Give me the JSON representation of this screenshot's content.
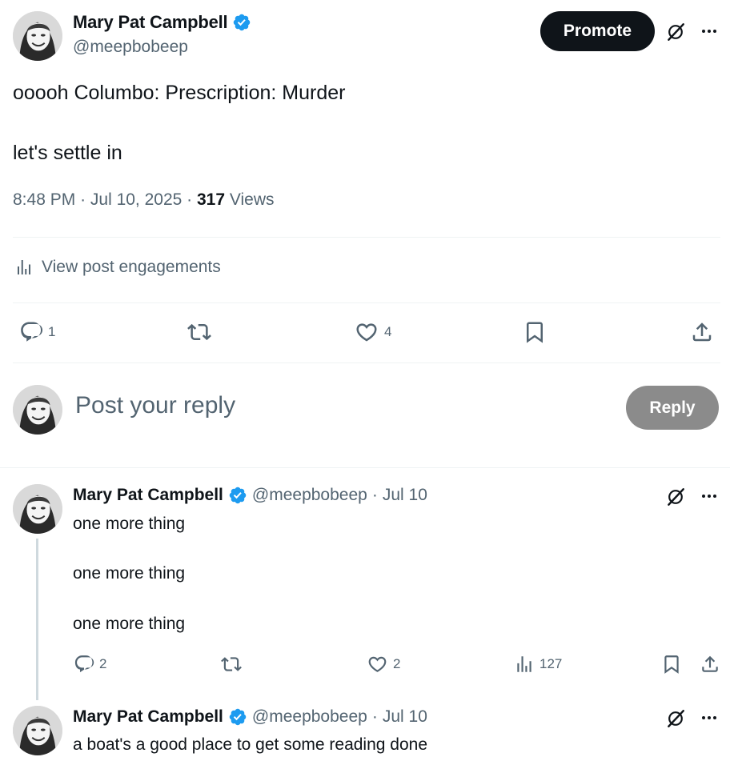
{
  "main_post": {
    "author": {
      "name": "Mary Pat Campbell",
      "handle": "@meepbobeep",
      "verified": true
    },
    "promote_label": "Promote",
    "text_line_1": "ooooh Columbo: Prescription: Murder",
    "text_line_2": "let's settle in",
    "time": "8:48 PM",
    "date": "Jul 10, 2025",
    "views_count": "317",
    "views_label": "Views",
    "engagements_label": "View post engagements",
    "actions": {
      "replies": "1",
      "reposts": "",
      "likes": "4"
    }
  },
  "composer": {
    "placeholder": "Post your reply",
    "reply_label": "Reply"
  },
  "replies": [
    {
      "name": "Mary Pat Campbell",
      "handle": "@meepbobeep",
      "sep": "·",
      "date": "Jul 10",
      "lines": [
        "one more thing",
        "one more thing",
        "one more thing"
      ],
      "stats": {
        "replies": "2",
        "reposts": "",
        "likes": "2",
        "views": "127"
      }
    },
    {
      "name": "Mary Pat Campbell",
      "handle": "@meepbobeep",
      "sep": "·",
      "date": "Jul 10",
      "lines": [
        "a boat's a good place to get some reading done"
      ]
    }
  ],
  "colors": {
    "text_primary": "#0f1419",
    "text_secondary": "#536471",
    "verified_blue": "#1d9bf0",
    "promote_bg": "#0f1419",
    "reply_button_bg": "#8b8b8b",
    "divider": "#eff3f4"
  },
  "icons": [
    "verified-badge-icon",
    "grok-icon",
    "more-icon",
    "analytics-icon",
    "reply-icon",
    "repost-icon",
    "like-icon",
    "bookmark-icon",
    "share-icon"
  ]
}
